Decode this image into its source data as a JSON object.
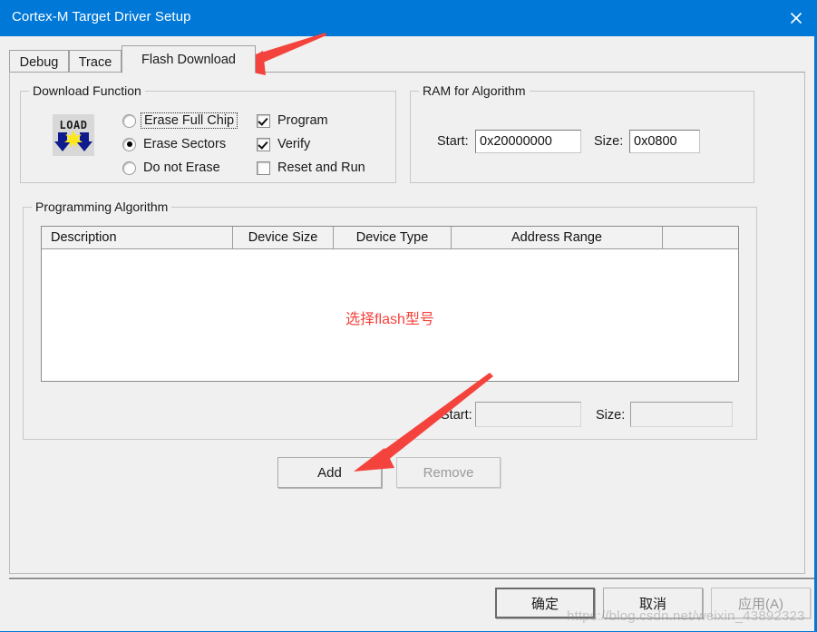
{
  "window": {
    "title": "Cortex-M Target Driver Setup",
    "close_icon": "close-icon",
    "accent_color": "#0078d7"
  },
  "tabs": [
    {
      "label": "Debug",
      "active": false
    },
    {
      "label": "Trace",
      "active": false
    },
    {
      "label": "Flash Download",
      "active": true
    }
  ],
  "download_function": {
    "title": "Download Function",
    "icon": "load-icon",
    "radios": [
      {
        "label": "Erase Full Chip",
        "selected": false,
        "focused": true
      },
      {
        "label": "Erase Sectors",
        "selected": true,
        "focused": false
      },
      {
        "label": "Do not Erase",
        "selected": false,
        "focused": false
      }
    ],
    "checkboxes": [
      {
        "label": "Program",
        "checked": true
      },
      {
        "label": "Verify",
        "checked": true
      },
      {
        "label": "Reset and Run",
        "checked": false
      }
    ]
  },
  "ram_for_algorithm": {
    "title": "RAM for Algorithm",
    "start_label": "Start:",
    "start_value": "0x20000000",
    "size_label": "Size:",
    "size_value": "0x0800"
  },
  "programming_algorithm": {
    "title": "Programming Algorithm",
    "columns": [
      "Description",
      "Device Size",
      "Device Type",
      "Address Range",
      ""
    ],
    "rows": [],
    "annotation": "选择flash型号",
    "annotation_color": "#f4433c",
    "start_label": "Start:",
    "start_value": "",
    "size_label": "Size:",
    "size_value": "",
    "add_label": "Add",
    "remove_label": "Remove",
    "remove_enabled": false
  },
  "dialog_buttons": {
    "ok": "确定",
    "cancel": "取消",
    "apply": "应用(A)",
    "apply_enabled": false
  },
  "watermark": "https://blog.csdn.net/weixin_43892323"
}
